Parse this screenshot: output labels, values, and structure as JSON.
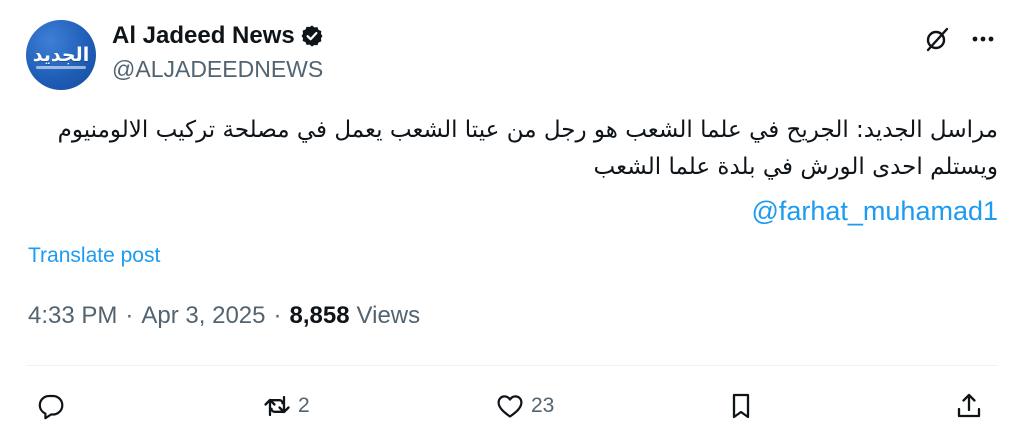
{
  "account": {
    "display_name": "Al Jadeed News",
    "handle": "@ALJADEEDNEWS",
    "avatar_text": "الجديد",
    "verified": true
  },
  "header_actions": {
    "grok_icon": "grok-slash-icon",
    "more_icon": "more-dots-icon"
  },
  "tweet": {
    "text": "مراسل الجديد: الجريح في علما الشعب هو رجل من عيتا الشعب يعمل في مصلحة تركيب الالومنيوم ويستلم احدى الورش في بلدة علما الشعب",
    "mention": "@farhat_muhamad1"
  },
  "translate_label": "Translate post",
  "meta": {
    "time": "4:33 PM",
    "dot": "·",
    "date": "Apr 3, 2025",
    "views_count": "8,858",
    "views_label": "Views"
  },
  "actions": {
    "reply_count": "",
    "repost_count": "2",
    "like_count": "23"
  },
  "colors": {
    "accent": "#1d9bf0",
    "secondary_text": "#536471",
    "primary_text": "#0f1419"
  }
}
